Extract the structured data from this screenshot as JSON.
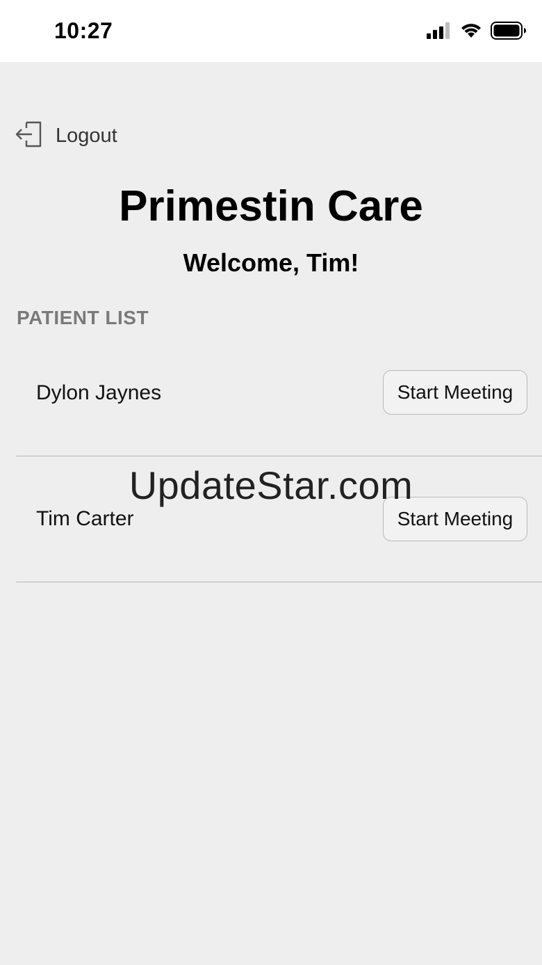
{
  "status_bar": {
    "time": "10:27",
    "icons": [
      "cellular-signal-icon",
      "wifi-icon",
      "battery-icon"
    ]
  },
  "header": {
    "logout_label": "Logout",
    "logout_icon": "logout-icon"
  },
  "app": {
    "title": "Primestin Care",
    "welcome": "Welcome, Tim!"
  },
  "patient_list": {
    "section_title": "PATIENT LIST",
    "patients": [
      {
        "name": "Dylon Jaynes",
        "action_label": "Start Meeting"
      },
      {
        "name": "Tim Carter",
        "action_label": "Start Meeting"
      }
    ]
  },
  "overlay": {
    "watermark": "UpdateStar.com"
  },
  "colors": {
    "background": "#eeeeee",
    "status_bar_bg": "#ffffff",
    "section_header": "#7a7a7a",
    "divider": "#b4b4b4"
  }
}
